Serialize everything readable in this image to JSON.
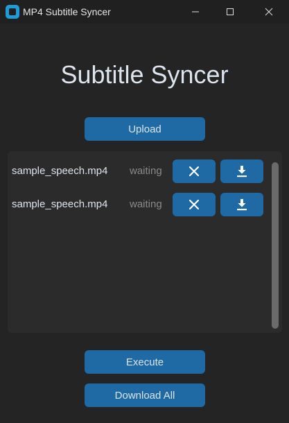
{
  "window": {
    "title": "MP4 Subtitle Syncer",
    "controls": [
      "minimize-icon",
      "maximize-icon",
      "close-icon"
    ]
  },
  "header": {
    "title": "Subtitle Syncer"
  },
  "actions": {
    "upload_label": "Upload",
    "execute_label": "Execute",
    "download_all_label": "Download All"
  },
  "files": [
    {
      "name": "sample_speech.mp4",
      "status": "waiting",
      "remove_icon": "x-icon",
      "download_icon": "download-icon"
    },
    {
      "name": "sample_speech.mp4",
      "status": "waiting",
      "remove_icon": "x-icon",
      "download_icon": "download-icon"
    }
  ],
  "colors": {
    "background": "#242424",
    "titlebar": "#202020",
    "panel": "#2b2b2b",
    "accent": "#1f6aa5",
    "text": "#dce4ee",
    "muted_text": "#8a8a8a",
    "scrollbar": "#6b6b6b"
  }
}
